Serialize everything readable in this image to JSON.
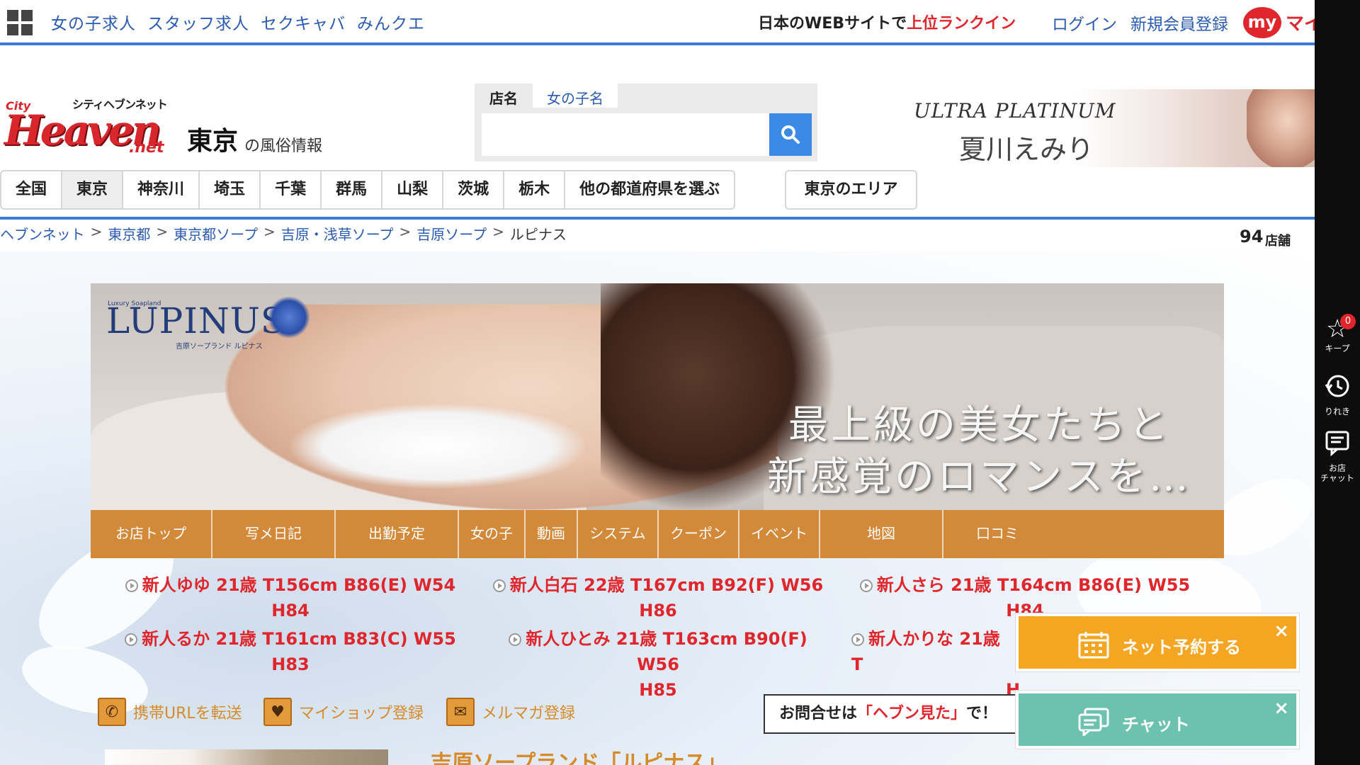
{
  "topbar": {
    "links": [
      "女の子求人",
      "スタッフ求人",
      "セクキャバ",
      "みんクエ"
    ],
    "rank_prefix": "日本のWEBサイトで",
    "rank_highlight": "上位ランクイン",
    "login": "ログイン",
    "register": "新規会員登録",
    "my_badge": "my",
    "my_text": "マイ"
  },
  "rail": {
    "keep_label": "キープ",
    "keep_count": "0",
    "history_label": "りれき",
    "chat_label": "お店\nチャット"
  },
  "logo": {
    "kana": "シティヘブンネット",
    "city": "City",
    "word": "Heaven",
    "net": ".net"
  },
  "region": {
    "title": "東京",
    "sub": "の風俗情報"
  },
  "search": {
    "tab_shop": "店名",
    "tab_girl": "女の子名",
    "placeholder": ""
  },
  "ad": {
    "title": "ULTRA PLATINUM",
    "name": "夏川えみり"
  },
  "pref_nav": {
    "tabs": [
      "全国",
      "東京",
      "神奈川",
      "埼玉",
      "千葉",
      "群馬",
      "山梨",
      "茨城",
      "栃木",
      "他の都道府県を選ぶ"
    ],
    "active": "東京",
    "area_button": "東京のエリア"
  },
  "breadcrumb": {
    "items": [
      "ヘブンネット",
      "東京都",
      "東京都ソープ",
      "吉原・浅草ソープ",
      "吉原ソープ"
    ],
    "current": "ルピナス",
    "separator": ">"
  },
  "shop_count": {
    "value": "94",
    "unit": "店舗"
  },
  "hero": {
    "logo": "LUPINUS",
    "logo_sub": "Luxury Soapland",
    "logo_tag": "吉原ソープランド ルピナス",
    "copy1": "最上級の美女たちと",
    "copy2": "新感覚のロマンスを…"
  },
  "shop_menu": {
    "tabs": [
      "お店トップ",
      "写メ日記",
      "出勤予定",
      "女の子",
      "動画",
      "システム",
      "クーポン",
      "イベント",
      "地図",
      "口コミ"
    ]
  },
  "new_girls": [
    {
      "line1": "新人ゆゆ 21歳 T156cm B86(E) W54",
      "line2": "H84"
    },
    {
      "line1": "新人白石 22歳 T167cm B92(F) W56",
      "line2": "H86"
    },
    {
      "line1": "新人さら 21歳 T164cm B86(E) W55",
      "line2": "H84"
    },
    {
      "line1": "新人るか 21歳 T161cm B83(C) W55",
      "line2": "H83"
    },
    {
      "line1": "新人ひとみ 21歳 T163cm B90(F) W56",
      "line2": "H85"
    },
    {
      "line1": "新人かりな 21歳 T",
      "line2": "H"
    }
  ],
  "actions": {
    "mobile_url": "携帯URLを転送",
    "my_shop": "マイショップ登録",
    "mail_mag": "メルマガ登録"
  },
  "inquiry": {
    "prefix": "お問合せは",
    "highlight": "「ヘブン見た」",
    "suffix": "で！"
  },
  "intro": {
    "heading": "吉原ソープランド「ルピナス」"
  },
  "floating": {
    "reserve": "ネット予約する",
    "chat": "チャット",
    "close": "×"
  },
  "colors": {
    "accent_blue": "#3a7bd5",
    "brand_red": "#e0262d",
    "shop_menu": "#d28a3a",
    "reserve": "#f4a521",
    "chat": "#6cc2ae"
  }
}
